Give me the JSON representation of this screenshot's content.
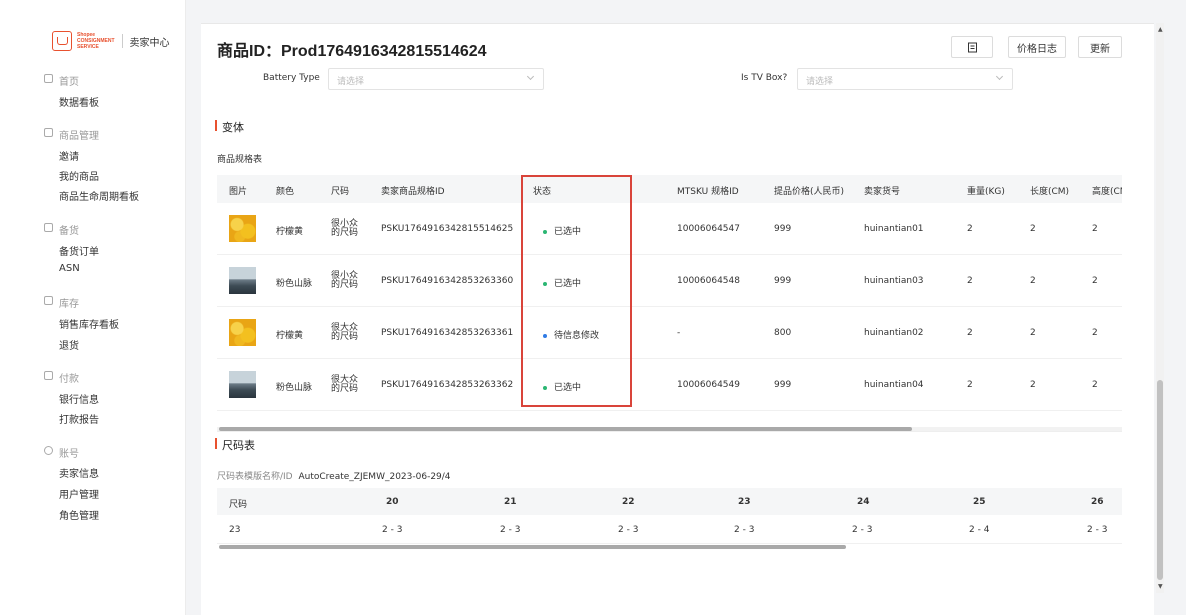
{
  "brand": {
    "logo_lines": [
      "Shopee",
      "CONSIGNMENT",
      "SERVICE"
    ],
    "title": "卖家中心"
  },
  "sidebar": {
    "groups": [
      {
        "title": "首页",
        "icon": "home-icon",
        "items": [
          "数据看板"
        ]
      },
      {
        "title": "商品管理",
        "icon": "product-icon",
        "items": [
          "邀请",
          "我的商品",
          "商品生命周期看板"
        ]
      },
      {
        "title": "备货",
        "icon": "stock-icon",
        "items": [
          "备货订单",
          "ASN"
        ]
      },
      {
        "title": "库存",
        "icon": "warehouse-icon",
        "items": [
          "销售库存看板",
          "退货"
        ]
      },
      {
        "title": "付款",
        "icon": "wallet-icon",
        "items": [
          "银行信息",
          "打款报告"
        ]
      },
      {
        "title": "账号",
        "icon": "account-icon",
        "items": [
          "卖家信息",
          "用户管理",
          "角色管理"
        ]
      }
    ]
  },
  "header": {
    "title": "商品ID：Prod1764916342815514624",
    "buttons": {
      "icon_button": "receipt-icon",
      "price_log": "价格日志",
      "update": "更新"
    }
  },
  "form": {
    "battery_label": "Battery Type",
    "battery_placeholder": "请选择",
    "tv_label": "Is TV Box?",
    "tv_placeholder": "请选择"
  },
  "variants": {
    "section_title": "变体",
    "table_label": "商品规格表",
    "columns": [
      "图片",
      "颜色",
      "尺码",
      "卖家商品规格ID",
      "状态",
      "MTSKU 规格ID",
      "提品价格(人民币)",
      "卖家货号",
      "重量(KG)",
      "长度(CM)",
      "高度(CM)"
    ],
    "rows": [
      {
        "image": "lemon",
        "color": "柠檬黄",
        "size": "很小众的尺码",
        "sku_id": "PSKU1764916342815514625",
        "status": "已选中",
        "status_color": "#2bb673",
        "mtsku": "10006064547",
        "price": "999",
        "seller_sku": "huinantian01",
        "weight": "2",
        "length": "2",
        "height": "2"
      },
      {
        "image": "mountain",
        "color": "粉色山脉",
        "size": "很小众的尺码",
        "sku_id": "PSKU1764916342853263360",
        "status": "已选中",
        "status_color": "#2bb673",
        "mtsku": "10006064548",
        "price": "999",
        "seller_sku": "huinantian03",
        "weight": "2",
        "length": "2",
        "height": "2"
      },
      {
        "image": "lemon",
        "color": "柠檬黄",
        "size": "很大众的尺码",
        "sku_id": "PSKU1764916342853263361",
        "status": "待信息修改",
        "status_color": "#2f7be5",
        "mtsku": "-",
        "price": "800",
        "seller_sku": "huinantian02",
        "weight": "2",
        "length": "2",
        "height": "2"
      },
      {
        "image": "mountain",
        "color": "粉色山脉",
        "size": "很大众的尺码",
        "sku_id": "PSKU1764916342853263362",
        "status": "已选中",
        "status_color": "#2bb673",
        "mtsku": "10006064549",
        "price": "999",
        "seller_sku": "huinantian04",
        "weight": "2",
        "length": "2",
        "height": "2"
      }
    ]
  },
  "size_chart": {
    "section_title": "尺码表",
    "template_label": "尺码表模版名称/ID",
    "template_value": "AutoCreate_ZJEMW_2023-06-29/4",
    "columns": [
      "尺码",
      "20",
      "21",
      "22",
      "23",
      "24",
      "25",
      "26"
    ],
    "row": [
      "23",
      "2 - 3",
      "2 - 3",
      "2 - 3",
      "2 - 3",
      "2 - 3",
      "2 - 4",
      "2 - 3"
    ]
  },
  "accent": "#e8512f",
  "highlight_color": "#d9443a"
}
